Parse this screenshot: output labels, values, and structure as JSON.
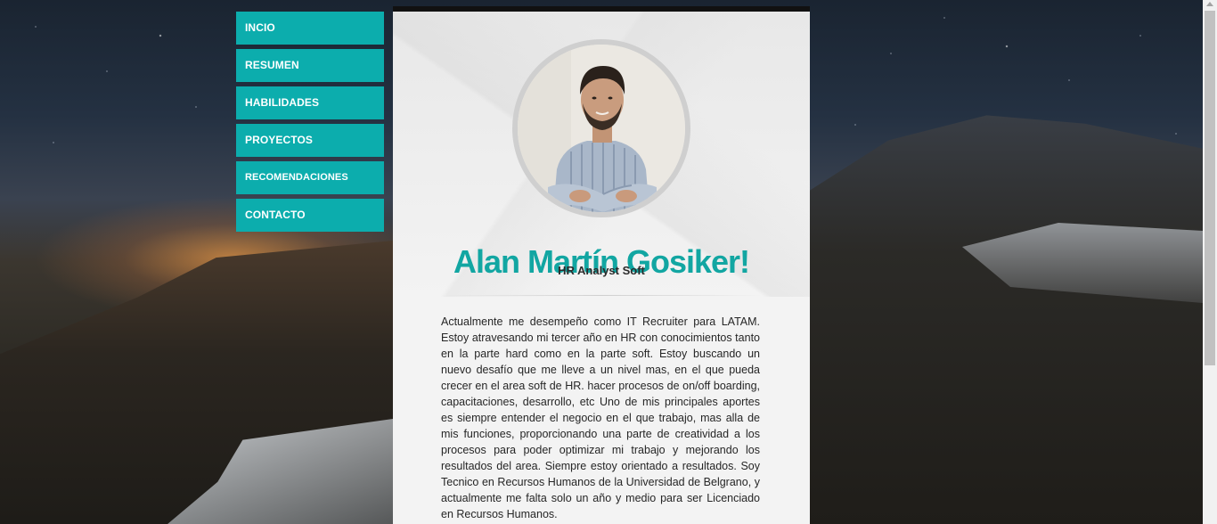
{
  "nav": {
    "items": [
      {
        "label": "INCIO"
      },
      {
        "label": "RESUMEN"
      },
      {
        "label": "HABILIDADES"
      },
      {
        "label": "PROYECTOS"
      },
      {
        "label": "RECOMENDACIONES"
      },
      {
        "label": "CONTACTO"
      }
    ]
  },
  "profile": {
    "name": "Alan Martín Gosiker!",
    "role": "HR Analyst Soft",
    "bio": "Actualmente me desempeño como IT Recruiter para LATAM. Estoy atravesando mi tercer año en HR con conocimientos tanto en la parte hard como en la parte soft. Estoy buscando un nuevo desafío que me lleve a un nivel mas, en el que pueda crecer en el area soft de HR. hacer procesos de on/off boarding, capacitaciones, desarrollo, etc Uno de mis principales aportes es siempre entender el negocio en el que trabajo, mas alla de mis funciones, proporcionando una parte de creatividad a los procesos para poder optimizar mi trabajo y mejorando los resultados del area. Siempre estoy orientado a resultados. Soy Tecnico en Recursos Humanos de la Universidad de Belgrano, y actualmente me falta solo un año y medio para ser Licenciado en Recursos Humanos."
  },
  "colors": {
    "accent": "#0cadad",
    "name_color": "#12a6a2",
    "card_bg": "#f3f3f3"
  }
}
